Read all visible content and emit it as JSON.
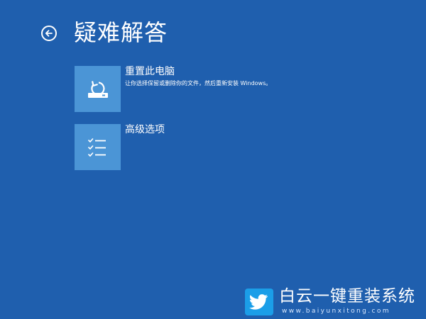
{
  "header": {
    "back_icon": "back-arrow-icon",
    "title": "疑难解答"
  },
  "options": [
    {
      "icon": "reset-pc-icon",
      "title": "重置此电脑",
      "description": "让你选择保留或删除你的文件，然后重新安装 Windows。"
    },
    {
      "icon": "checklist-icon",
      "title": "高级选项",
      "description": ""
    }
  ],
  "watermark": {
    "logo_icon": "bird-logo-icon",
    "title": "白云一键重装系统",
    "url": "www.baiyunxitong.com"
  },
  "colors": {
    "background": "#1f5fae",
    "tile": "#4b95d6",
    "text": "#ffffff",
    "watermark_logo": "#1b9ee8"
  }
}
